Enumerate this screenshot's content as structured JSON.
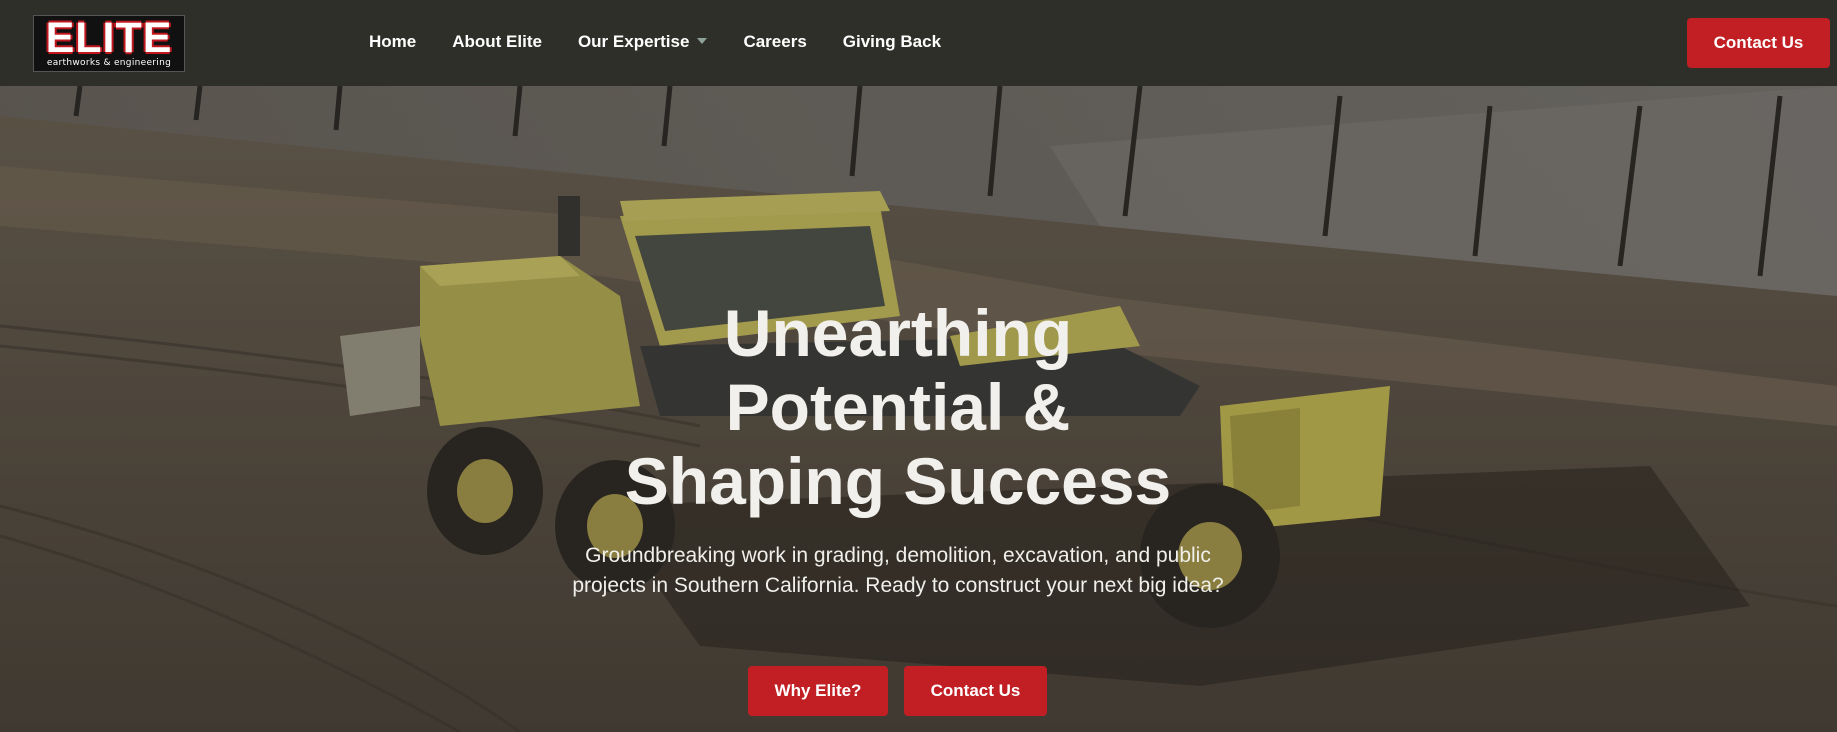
{
  "brand": {
    "logo_text": "ELITE",
    "tagline": "earthworks & engineering"
  },
  "nav": {
    "items": [
      {
        "label": "Home"
      },
      {
        "label": "About Elite"
      },
      {
        "label": "Our Expertise",
        "has_dropdown": true
      },
      {
        "label": "Careers"
      },
      {
        "label": "Giving Back"
      }
    ],
    "cta_label": "Contact Us"
  },
  "hero": {
    "title_lines": [
      "Unearthing",
      "Potential &",
      "Shaping Success"
    ],
    "subtitle": "Groundbreaking work in grading, demolition, excavation, and public projects in Southern California. Ready to construct your next big idea?",
    "primary_button": "Why Elite?",
    "secondary_button": "Contact Us"
  },
  "colors": {
    "header_bg": "#2f2f2a",
    "accent_red": "#c11f24",
    "text_light": "#f2f0ec"
  }
}
